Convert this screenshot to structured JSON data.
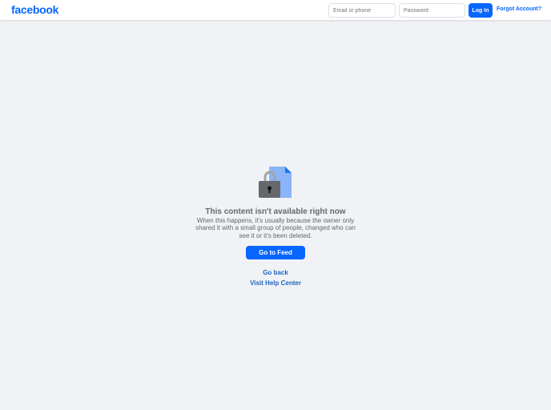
{
  "header": {
    "logo": "facebook",
    "email_placeholder": "Email or phone",
    "password_placeholder": "Password",
    "login_label": "Log In",
    "forgot_label": "Forgot Account?"
  },
  "main": {
    "title": "This content isn't available right now",
    "message": "When this happens, it's usually because the owner only shared it with a small group of people, changed who can see it or it's been deleted.",
    "feed_label": "Go to Feed",
    "back_label": "Go back",
    "help_label": "Visit Help Center"
  },
  "colors": {
    "brand": "#0866ff",
    "background": "#f0f2f5"
  }
}
